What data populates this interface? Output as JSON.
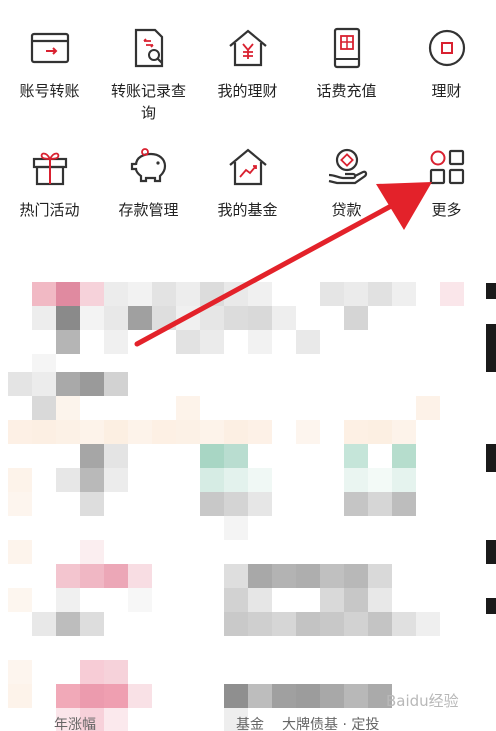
{
  "menu": {
    "items": [
      {
        "label": "账号转账",
        "icon": "transfer-card-icon"
      },
      {
        "label": "转账记录查询",
        "icon": "transfer-record-search-icon"
      },
      {
        "label": "我的理财",
        "icon": "house-yen-icon"
      },
      {
        "label": "话费充值",
        "icon": "phone-recharge-icon"
      },
      {
        "label": "理财",
        "icon": "circle-square-icon"
      },
      {
        "label": "热门活动",
        "icon": "gift-box-icon"
      },
      {
        "label": "存款管理",
        "icon": "piggy-bank-icon"
      },
      {
        "label": "我的基金",
        "icon": "house-chart-icon"
      },
      {
        "label": "贷款",
        "icon": "hand-coin-icon"
      },
      {
        "label": "更多",
        "icon": "grid-more-icon"
      }
    ]
  },
  "bottom_partial": {
    "left": "年涨幅",
    "middle": "基金",
    "right": "大牌债基 · 定投"
  },
  "watermark": "Baidu经验",
  "colors": {
    "accent_red": "#d92130",
    "annotation_arrow": "#e3222a"
  }
}
